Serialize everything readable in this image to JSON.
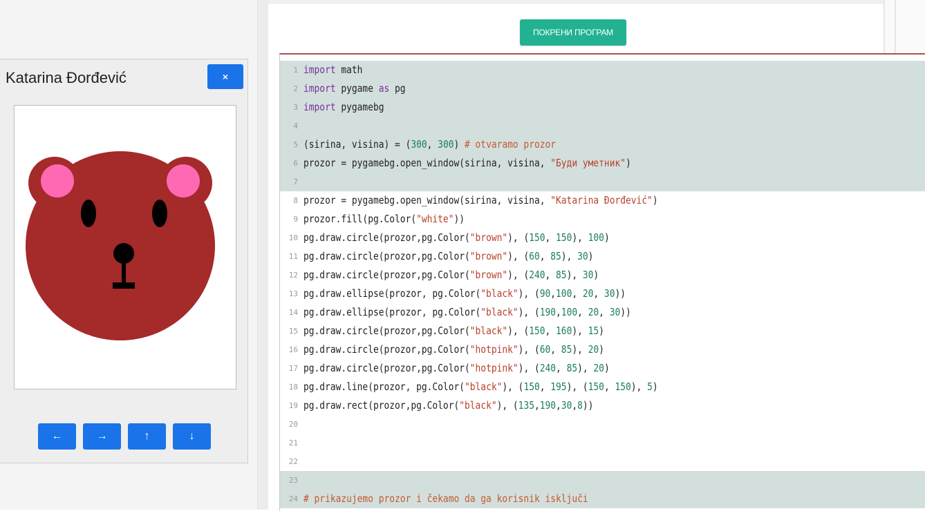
{
  "toolbar": {
    "run_label": "ПОКРЕНИ ПРОГРАМ"
  },
  "window": {
    "title": "Katarina Đorđević",
    "close_label": "×",
    "arrows": [
      "←",
      "→",
      "↑",
      "↓"
    ]
  },
  "bear": {
    "head_color": "#a52a2a",
    "ear_inner_color": "#ff69b4",
    "feature_color": "#000000"
  },
  "editor": {
    "colors": {
      "highlight": "#d3dfdd",
      "keyword": "#7a2e9e",
      "string": "#b8412b",
      "number": "#1a7f5a",
      "comment": "#c25a30"
    },
    "lines": [
      {
        "n": "1",
        "hl": true,
        "tokens": [
          [
            "kw",
            "import"
          ],
          [
            "t",
            " math"
          ]
        ]
      },
      {
        "n": "2",
        "hl": true,
        "tokens": [
          [
            "kw",
            "import"
          ],
          [
            "t",
            " pygame "
          ],
          [
            "kw",
            "as"
          ],
          [
            "t",
            " pg"
          ]
        ]
      },
      {
        "n": "3",
        "hl": true,
        "tokens": [
          [
            "kw",
            "import"
          ],
          [
            "t",
            " pygamebg"
          ]
        ]
      },
      {
        "n": "4",
        "hl": true,
        "tokens": []
      },
      {
        "n": "5",
        "hl": true,
        "tokens": [
          [
            "t",
            "(sirina, visina) = ("
          ],
          [
            "num",
            "300"
          ],
          [
            "t",
            ", "
          ],
          [
            "num",
            "300"
          ],
          [
            "t",
            ") "
          ],
          [
            "cmt",
            "# otvaramo prozor"
          ]
        ]
      },
      {
        "n": "6",
        "hl": true,
        "tokens": [
          [
            "t",
            "prozor = pygamebg.open_window(sirina, visina, "
          ],
          [
            "str",
            "\"Буди уметник\""
          ],
          [
            "t",
            ")"
          ]
        ]
      },
      {
        "n": "7",
        "hl": true,
        "tokens": []
      },
      {
        "n": "8",
        "hl": false,
        "tokens": [
          [
            "t",
            "prozor = pygamebg.open_window(sirina, visina, "
          ],
          [
            "str",
            "\"Katarina Đorđević\""
          ],
          [
            "t",
            ")"
          ]
        ]
      },
      {
        "n": "9",
        "hl": false,
        "tokens": [
          [
            "t",
            "prozor.fill(pg.Color("
          ],
          [
            "str",
            "\"white\""
          ],
          [
            "t",
            "))"
          ]
        ]
      },
      {
        "n": "10",
        "hl": false,
        "tokens": [
          [
            "t",
            "pg.draw.circle(prozor,pg.Color("
          ],
          [
            "str",
            "\"brown\""
          ],
          [
            "t",
            "), ("
          ],
          [
            "num",
            "150"
          ],
          [
            "t",
            ", "
          ],
          [
            "num",
            "150"
          ],
          [
            "t",
            "), "
          ],
          [
            "num",
            "100"
          ],
          [
            "t",
            ")"
          ]
        ]
      },
      {
        "n": "11",
        "hl": false,
        "tokens": [
          [
            "t",
            "pg.draw.circle(prozor,pg.Color("
          ],
          [
            "str",
            "\"brown\""
          ],
          [
            "t",
            "), ("
          ],
          [
            "num",
            "60"
          ],
          [
            "t",
            ", "
          ],
          [
            "num",
            "85"
          ],
          [
            "t",
            "), "
          ],
          [
            "num",
            "30"
          ],
          [
            "t",
            ")"
          ]
        ]
      },
      {
        "n": "12",
        "hl": false,
        "tokens": [
          [
            "t",
            "pg.draw.circle(prozor,pg.Color("
          ],
          [
            "str",
            "\"brown\""
          ],
          [
            "t",
            "), ("
          ],
          [
            "num",
            "240"
          ],
          [
            "t",
            ", "
          ],
          [
            "num",
            "85"
          ],
          [
            "t",
            "), "
          ],
          [
            "num",
            "30"
          ],
          [
            "t",
            ")"
          ]
        ]
      },
      {
        "n": "13",
        "hl": false,
        "tokens": [
          [
            "t",
            "pg.draw.ellipse(prozor, pg.Color("
          ],
          [
            "str",
            "\"black\""
          ],
          [
            "t",
            "), ("
          ],
          [
            "num",
            "90"
          ],
          [
            "t",
            ","
          ],
          [
            "num",
            "100"
          ],
          [
            "t",
            ", "
          ],
          [
            "num",
            "20"
          ],
          [
            "t",
            ", "
          ],
          [
            "num",
            "30"
          ],
          [
            "t",
            "))"
          ]
        ]
      },
      {
        "n": "14",
        "hl": false,
        "tokens": [
          [
            "t",
            "pg.draw.ellipse(prozor, pg.Color("
          ],
          [
            "str",
            "\"black\""
          ],
          [
            "t",
            "), ("
          ],
          [
            "num",
            "190"
          ],
          [
            "t",
            ","
          ],
          [
            "num",
            "100"
          ],
          [
            "t",
            ", "
          ],
          [
            "num",
            "20"
          ],
          [
            "t",
            ", "
          ],
          [
            "num",
            "30"
          ],
          [
            "t",
            "))"
          ]
        ]
      },
      {
        "n": "15",
        "hl": false,
        "tokens": [
          [
            "t",
            "pg.draw.circle(prozor,pg.Color("
          ],
          [
            "str",
            "\"black\""
          ],
          [
            "t",
            "), ("
          ],
          [
            "num",
            "150"
          ],
          [
            "t",
            ", "
          ],
          [
            "num",
            "160"
          ],
          [
            "t",
            "), "
          ],
          [
            "num",
            "15"
          ],
          [
            "t",
            ")"
          ]
        ]
      },
      {
        "n": "16",
        "hl": false,
        "tokens": [
          [
            "t",
            "pg.draw.circle(prozor,pg.Color("
          ],
          [
            "str",
            "\"hotpink\""
          ],
          [
            "t",
            "), ("
          ],
          [
            "num",
            "60"
          ],
          [
            "t",
            ", "
          ],
          [
            "num",
            "85"
          ],
          [
            "t",
            "), "
          ],
          [
            "num",
            "20"
          ],
          [
            "t",
            ")"
          ]
        ]
      },
      {
        "n": "17",
        "hl": false,
        "tokens": [
          [
            "t",
            "pg.draw.circle(prozor,pg.Color("
          ],
          [
            "str",
            "\"hotpink\""
          ],
          [
            "t",
            "), ("
          ],
          [
            "num",
            "240"
          ],
          [
            "t",
            ", "
          ],
          [
            "num",
            "85"
          ],
          [
            "t",
            "), "
          ],
          [
            "num",
            "20"
          ],
          [
            "t",
            ")"
          ]
        ]
      },
      {
        "n": "18",
        "hl": false,
        "tokens": [
          [
            "t",
            "pg.draw.line(prozor, pg.Color("
          ],
          [
            "str",
            "\"black\""
          ],
          [
            "t",
            "), ("
          ],
          [
            "num",
            "150"
          ],
          [
            "t",
            ", "
          ],
          [
            "num",
            "195"
          ],
          [
            "t",
            "), ("
          ],
          [
            "num",
            "150"
          ],
          [
            "t",
            ", "
          ],
          [
            "num",
            "150"
          ],
          [
            "t",
            "), "
          ],
          [
            "num",
            "5"
          ],
          [
            "t",
            ")"
          ]
        ]
      },
      {
        "n": "19",
        "hl": false,
        "tokens": [
          [
            "t",
            "pg.draw.rect(prozor,pg.Color("
          ],
          [
            "str",
            "\"black\""
          ],
          [
            "t",
            "), ("
          ],
          [
            "num",
            "135"
          ],
          [
            "t",
            ","
          ],
          [
            "num",
            "190"
          ],
          [
            "t",
            ","
          ],
          [
            "num",
            "30"
          ],
          [
            "t",
            ","
          ],
          [
            "num",
            "8"
          ],
          [
            "t",
            "))"
          ]
        ]
      },
      {
        "n": "20",
        "hl": false,
        "tokens": []
      },
      {
        "n": "21",
        "hl": false,
        "tokens": []
      },
      {
        "n": "22",
        "hl": false,
        "tokens": []
      },
      {
        "n": "23",
        "hl": true,
        "tokens": []
      },
      {
        "n": "24",
        "hl": true,
        "tokens": [
          [
            "cmt",
            "# prikazujemo prozor i čekamo da ga korisnik isključi"
          ]
        ]
      }
    ]
  }
}
